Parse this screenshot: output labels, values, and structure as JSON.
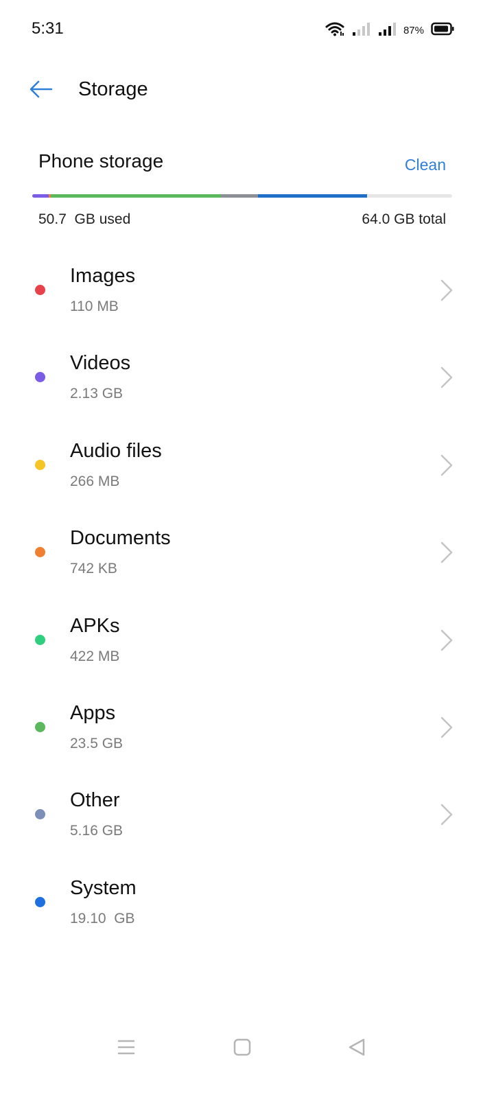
{
  "status_bar": {
    "time": "5:31",
    "battery_percent": "87%",
    "icons": [
      "wifi-icon",
      "signal-sim1-icon",
      "signal-sim2-icon",
      "battery-icon"
    ]
  },
  "header": {
    "title": "Storage",
    "back_icon": "arrow-left-icon",
    "accent_color": "#2f7fd6"
  },
  "storage": {
    "section_title": "Phone storage",
    "clean_label": "Clean",
    "used_label": "50.7  GB used",
    "total_label": "64.0 GB total",
    "used_fraction": 0.792
  },
  "categories": [
    {
      "name": "Images",
      "size": "110 MB",
      "color": "#e5424b",
      "has_chevron": true
    },
    {
      "name": "Videos",
      "size": "2.13 GB",
      "color": "#7b5ce6",
      "has_chevron": true
    },
    {
      "name": "Audio files",
      "size": "266 MB",
      "color": "#f5c425",
      "has_chevron": true
    },
    {
      "name": "Documents",
      "size": "742 KB",
      "color": "#f07f32",
      "has_chevron": true
    },
    {
      "name": "APKs",
      "size": "422 MB",
      "color": "#2fcf7f",
      "has_chevron": true
    },
    {
      "name": "Apps",
      "size": "23.5 GB",
      "color": "#5cb85c",
      "has_chevron": true
    },
    {
      "name": "Other",
      "size": "5.16 GB",
      "color": "#7d8fb8",
      "has_chevron": true
    },
    {
      "name": "System",
      "size": "19.10  GB",
      "color": "#1f6fe0",
      "has_chevron": false
    }
  ],
  "nav_bar": {
    "icons": [
      "menu-icon",
      "home-square-icon",
      "back-triangle-icon"
    ]
  }
}
